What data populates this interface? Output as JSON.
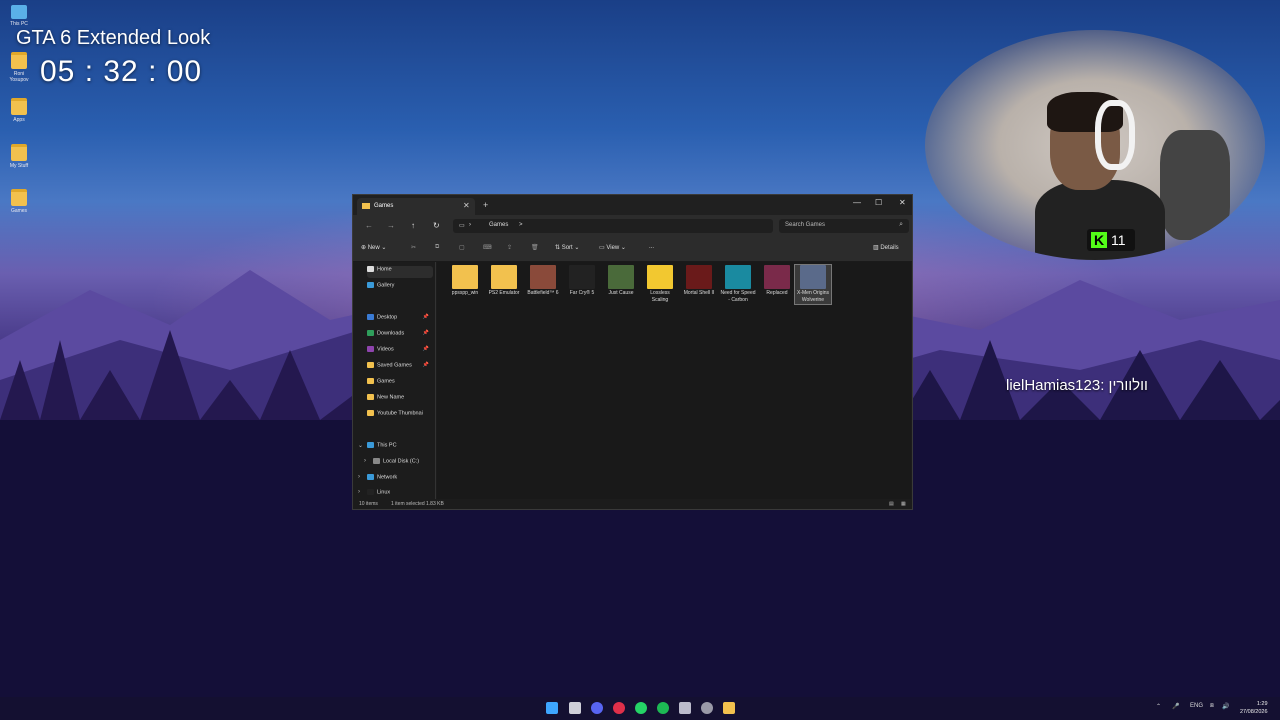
{
  "overlay": {
    "title": "GTA 6 Extended Look",
    "timer": "05 : 32 : 00"
  },
  "desktop_icons": [
    {
      "label": "This PC",
      "icon": "pc-icon"
    },
    {
      "label": "Roni Yosupov",
      "icon": "folder-icon"
    },
    {
      "label": "Apps",
      "icon": "folder-icon"
    },
    {
      "label": "My Stuff",
      "icon": "folder-icon"
    },
    {
      "label": "Games",
      "icon": "folder-icon"
    }
  ],
  "webcam": {
    "badge_count": "11"
  },
  "chat": {
    "message": "lielHamias123: וולוורין"
  },
  "explorer": {
    "tab_title": "Games",
    "breadcrumb": [
      "Games",
      ">"
    ],
    "search_placeholder": "Search Games",
    "toolbar": {
      "new": "New",
      "sort": "Sort",
      "view": "View",
      "more": "...",
      "details": "Details"
    },
    "nav": {
      "home": "Home",
      "gallery": "Gallery",
      "quick_access": [
        {
          "label": "Desktop",
          "color": "#3a7bd5"
        },
        {
          "label": "Downloads",
          "color": "#2f9e5b"
        },
        {
          "label": "Videos",
          "color": "#8e44ad"
        },
        {
          "label": "Saved Games",
          "color": "#f2c14e"
        },
        {
          "label": "Games",
          "color": "#f2c14e"
        },
        {
          "label": "New Name",
          "color": "#f2c14e"
        },
        {
          "label": "Youtube Thumbnai",
          "color": "#f2c14e"
        }
      ],
      "this_pc": "This PC",
      "local_disk": "Local Disk (C:)",
      "network": "Network",
      "linux": "Linux"
    },
    "files": [
      {
        "name": "ppsspp_win",
        "color": "#f2c14e"
      },
      {
        "name": "PS2 Emulator",
        "color": "#f2c14e"
      },
      {
        "name": "Battlefield™ 6",
        "color": "#8a4a3a"
      },
      {
        "name": "Far Cry® 5",
        "color": "#222222"
      },
      {
        "name": "Just Cause",
        "color": "#4a6a3a"
      },
      {
        "name": "Lossless Scaling",
        "color": "#f2c830"
      },
      {
        "name": "Mortal Shell II",
        "color": "#6a1a1a"
      },
      {
        "name": "Need for Speed - Carbon",
        "color": "#1a8aa0"
      },
      {
        "name": "Replaced",
        "color": "#7a2a4a"
      },
      {
        "name": "X-Men Origins Wolverine",
        "color": "#5a6a8a",
        "selected": true
      }
    ],
    "status": {
      "items": "10 items",
      "selected": "1 item selected  1.83 KB"
    }
  },
  "taskbar": {
    "lang": "ENG",
    "time": "1:29",
    "date": "27/08/2026"
  }
}
